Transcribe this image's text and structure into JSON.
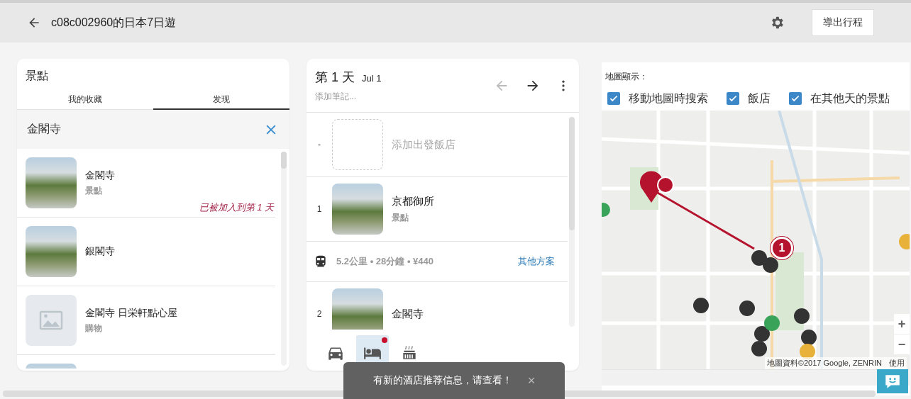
{
  "header": {
    "title": "c08c002960的日本7日遊",
    "export_button": "導出行程"
  },
  "attractions": {
    "title": "景點",
    "tabs": [
      {
        "label": "我的收藏",
        "selected": false
      },
      {
        "label": "发现",
        "selected": true
      }
    ],
    "search": {
      "value": "金閣寺"
    },
    "results": [
      {
        "kind": "photo",
        "name": "金閣寺",
        "category": "景點",
        "note": "已被加入到第 1 天"
      },
      {
        "kind": "photo",
        "name": "銀閣寺"
      },
      {
        "kind": "placeholder",
        "name": "金閣寺 日栄軒點心屋",
        "category": "購物"
      },
      {
        "kind": "photo"
      }
    ]
  },
  "day": {
    "title": "第 1 天",
    "date": "Jul 1",
    "notes_placeholder": "添加筆記...",
    "prev_disabled": true,
    "next_disabled": false,
    "stops": [
      {
        "kind": "hotel",
        "index": "-",
        "label": "添加出發飯店"
      },
      {
        "kind": "place",
        "index": "1",
        "name": "京都御所",
        "category": "景點"
      },
      {
        "kind": "transit",
        "summary": "5.2公里 • 28分鐘 • ¥440",
        "link": "其他方案"
      },
      {
        "kind": "place",
        "index": "2",
        "name": "金閣寺"
      }
    ],
    "tools": [
      {
        "kind": "car",
        "selected": false,
        "badge": false
      },
      {
        "kind": "bed",
        "selected": true,
        "badge": true
      },
      {
        "kind": "onsen",
        "selected": false,
        "badge": false
      }
    ]
  },
  "map": {
    "label": "地圖顯示：",
    "options": [
      {
        "label": "移動地圖時搜索",
        "checked": true
      },
      {
        "label": "飯店",
        "checked": true
      },
      {
        "label": "在其他天的景點",
        "checked": true
      }
    ],
    "marker": "1",
    "zoom_in": "+",
    "zoom_out": "−",
    "attribution": "地圖資料©2017 Google, ZENRIN",
    "terms": "使用"
  },
  "toast": {
    "message": "有新的酒店推荐信息，请查看！",
    "close": "×"
  }
}
